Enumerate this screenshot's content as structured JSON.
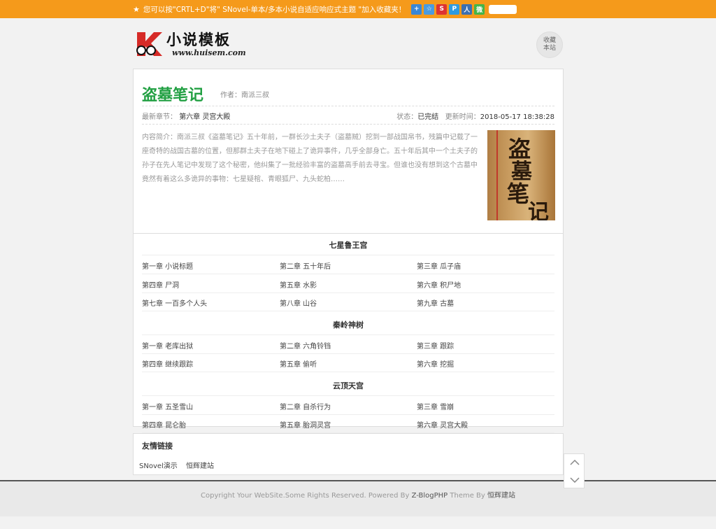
{
  "topbar": {
    "notice": "您可以按\"CRTL+D\"将\" SNovel-单本/多本小说自适应响应式主题 \"加入收藏夹！",
    "share_icons": [
      {
        "name": "share-plus-icon",
        "color": "#3a87d6",
        "glyph": "+"
      },
      {
        "name": "share-star-icon",
        "color": "#4a9be0",
        "glyph": "☆"
      },
      {
        "name": "share-weibo-icon",
        "color": "#d33",
        "glyph": "S"
      },
      {
        "name": "share-qzone-icon",
        "color": "#2e9be0",
        "glyph": "P"
      },
      {
        "name": "share-renren-icon",
        "color": "#3c6fb0",
        "glyph": "人"
      },
      {
        "name": "share-wechat-icon",
        "color": "#44b549",
        "glyph": "微"
      }
    ]
  },
  "logo": {
    "title": "小说模板",
    "url": "www.huisem.com"
  },
  "favorite": {
    "line1": "收藏",
    "line2": "本站"
  },
  "book": {
    "title": "盗墓笔记",
    "author": "作者：南派三叔",
    "latest_label": "最新章节：",
    "latest_chapter": "第六章 灵宫大殿",
    "status_label": "状态：",
    "status_value": "已完结",
    "updated_label": "更新时间：",
    "updated_value": "2018-05-17 18:38:28",
    "intro": "内容简介：南派三叔《盗墓笔记》五十年前，一群长沙土夫子（盗墓贼）挖到一部战国帛书，残篇中记载了一座奇特的战国古墓的位置，但那群土夫子在地下碰上了诡异事件，几乎全部身亡。五十年后其中一个土夫子的孙子在先人笔记中发现了这个秘密，他纠集了一批经验丰富的盗墓高手前去寻宝。但谁也没有想到这个古墓中竟然有着这么多诡异的事物：七星疑棺、青眼狐尸、九头蛇柏……",
    "cover_text": "盗墓笔记"
  },
  "volumes": [
    {
      "title": "七星鲁王宫",
      "chapters": [
        "第一章 小说标题",
        "第二章 五十年后",
        "第三章 瓜子庙",
        "第四章 尸洞",
        "第五章 水影",
        "第六章 积尸地",
        "第七章 一百多个人头",
        "第八章 山谷",
        "第九章 古墓"
      ]
    },
    {
      "title": "秦岭神树",
      "chapters": [
        "第一章 老库出狱",
        "第二章 六角铃铛",
        "第三章 跟踪",
        "第四章 继续跟踪",
        "第五章 偷听",
        "第六章 挖掘"
      ]
    },
    {
      "title": "云顶天宫",
      "chapters": [
        "第一章 五圣雪山",
        "第二章 自杀行为",
        "第三章 雪崩",
        "第四章 昆仑胎",
        "第五章 胎洞灵宫",
        "第六章 灵宫大殿"
      ]
    }
  ],
  "links": {
    "title": "友情链接",
    "items": [
      "SNovel演示",
      "恒辉建站"
    ]
  },
  "footer": {
    "text_before": "Copyright Your WebSite.Some Rights Reserved. Powered By ",
    "powered": "Z-BlogPHP",
    "text_mid": " Theme By ",
    "theme": "恒辉建站"
  },
  "colors": {
    "topbar": "#f59a1b",
    "title_green": "#22a043"
  }
}
